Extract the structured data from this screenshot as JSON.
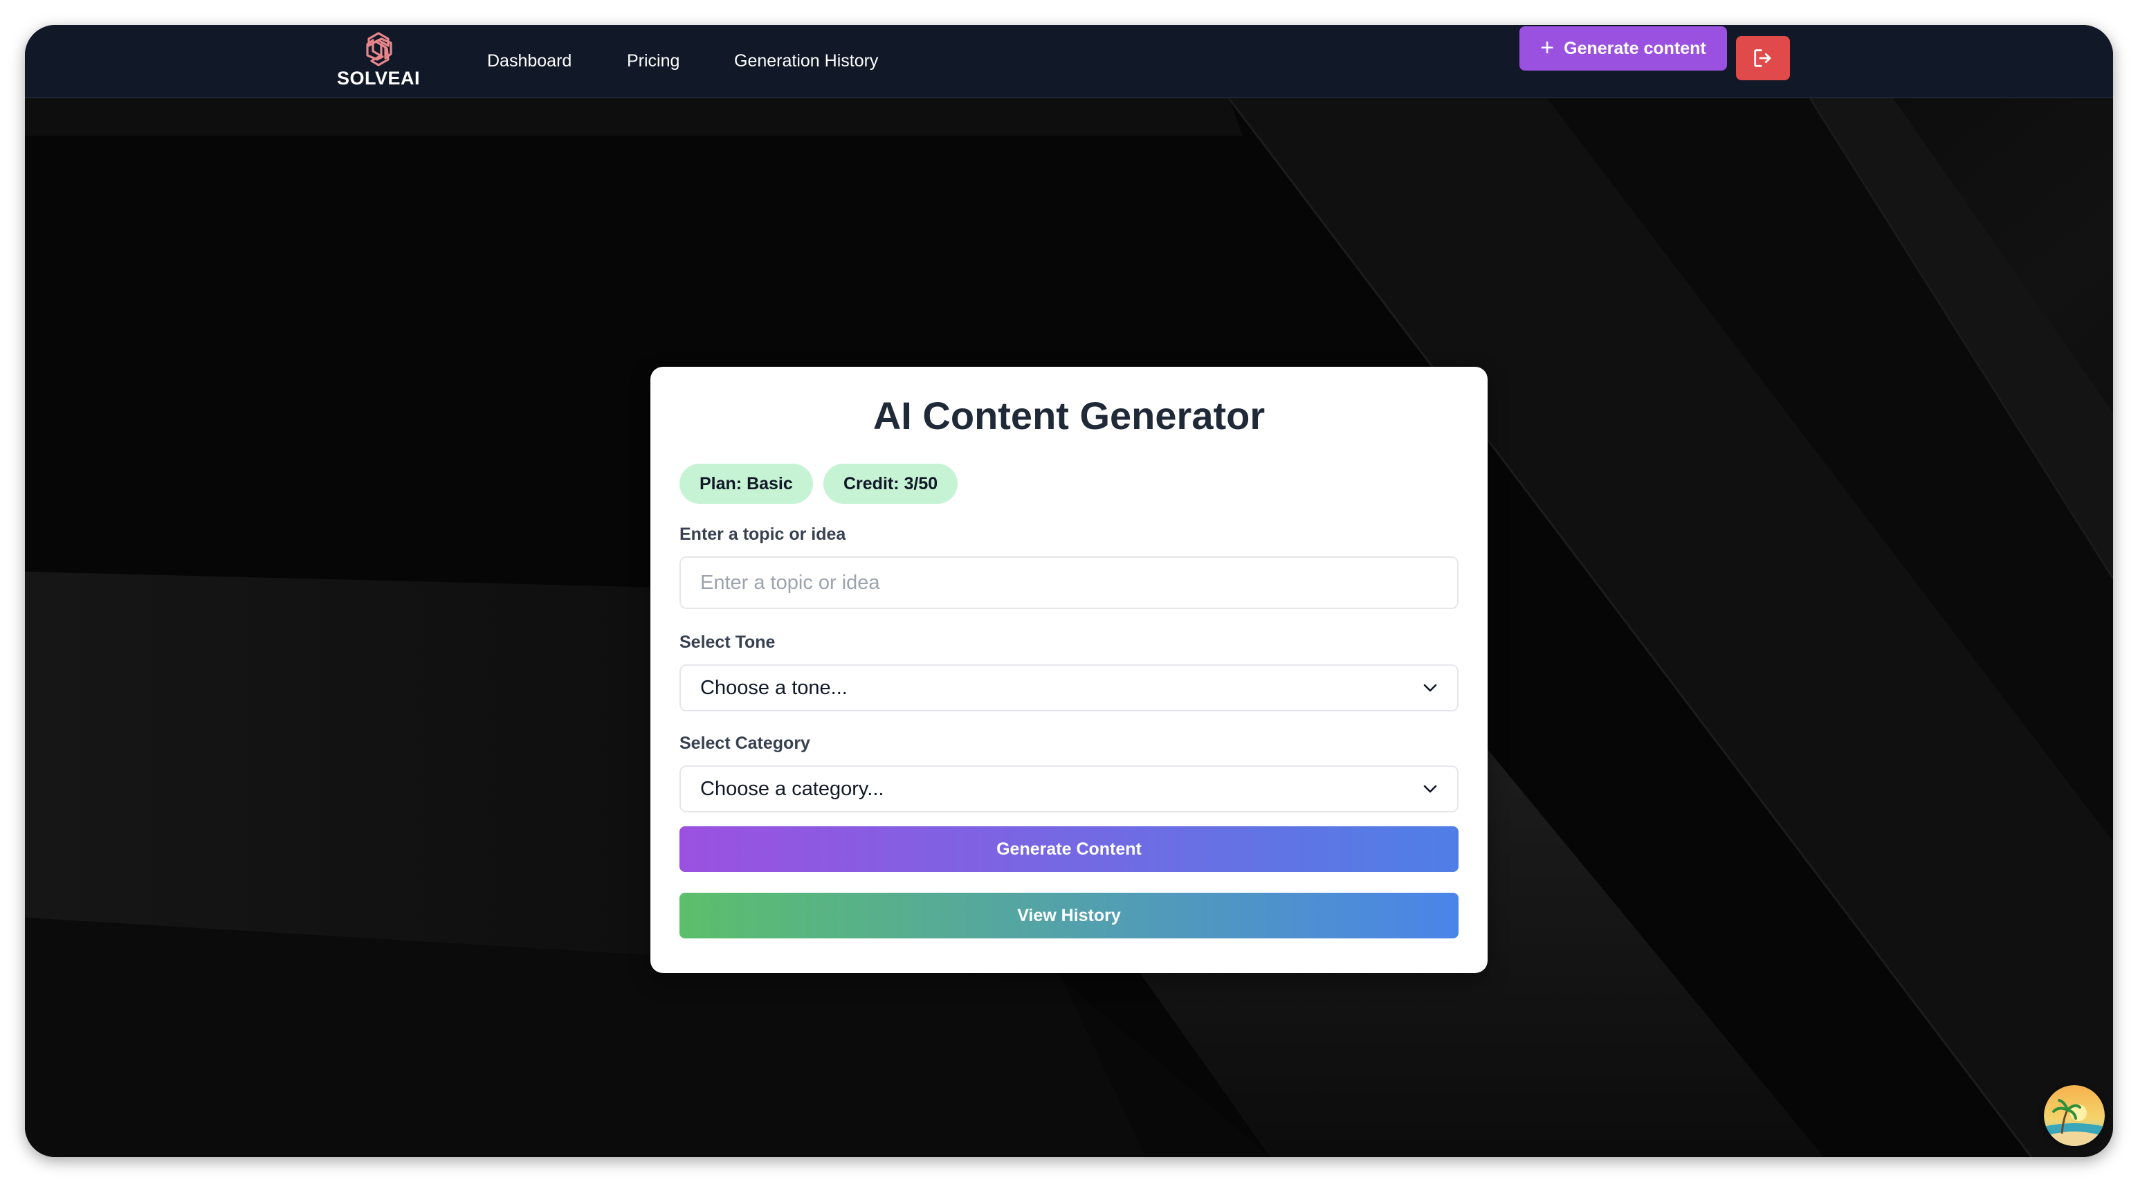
{
  "brand": {
    "name": "SOLVEAI",
    "logo_icon": "solveai-logo-icon"
  },
  "nav": {
    "links": [
      {
        "label": "Dashboard"
      },
      {
        "label": "Pricing"
      },
      {
        "label": "Generation History"
      }
    ],
    "generate_label": "Generate content",
    "generate_icon": "plus-icon",
    "logout_icon": "logout-icon"
  },
  "card": {
    "title": "AI Content Generator",
    "plan_badge": "Plan: Basic",
    "credit_badge": "Credit: 3/50",
    "topic": {
      "label": "Enter a topic or idea",
      "placeholder": "Enter a topic or idea",
      "value": ""
    },
    "tone": {
      "label": "Select Tone",
      "selected": "Choose a tone..."
    },
    "category": {
      "label": "Select Category",
      "selected": "Choose a category..."
    },
    "generate_button": "Generate Content",
    "history_button": "View History"
  },
  "colors": {
    "navbar": "#111827",
    "accent_purple": "#9b51e0",
    "logout_red": "#e04a4a",
    "badge_green": "#c6f3d4"
  },
  "avatar": {
    "icon": "beach-avatar-icon"
  }
}
